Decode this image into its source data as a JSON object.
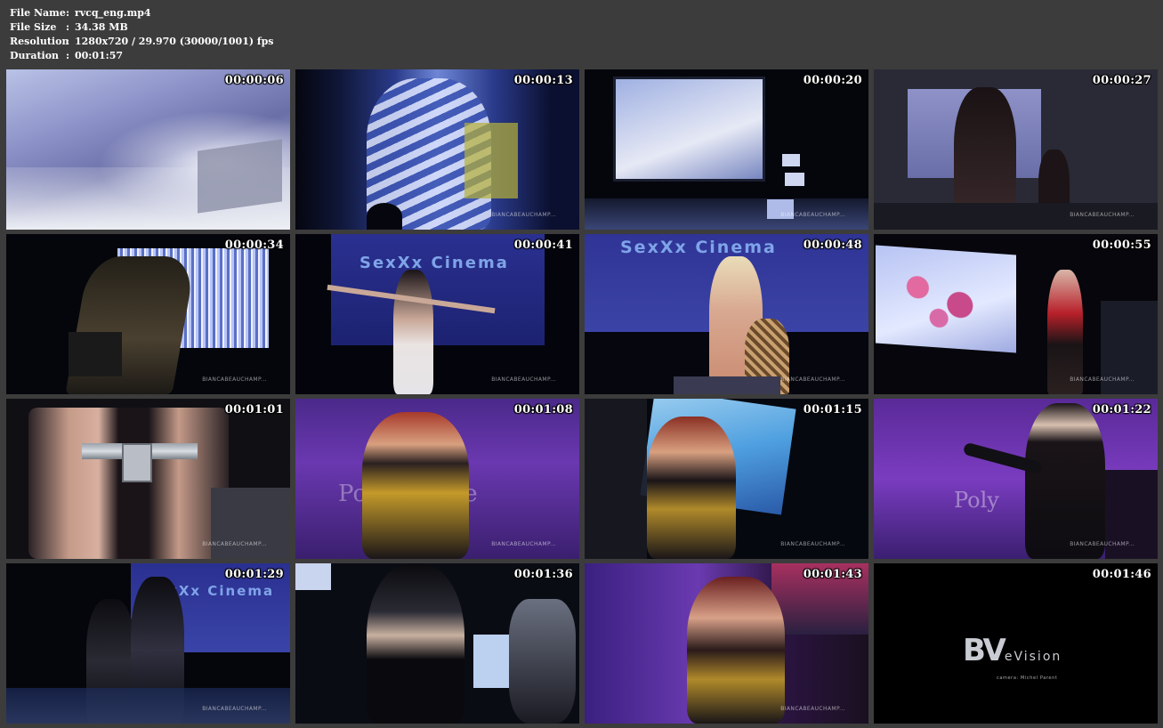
{
  "header": {
    "file_name_label": "File Name",
    "file_name": "rvcq_eng.mp4",
    "file_size_label": "File Size",
    "file_size": "34.38 MB",
    "resolution_label": "Resolution",
    "resolution": "1280x720 / 29.970 (30000/1001) fps",
    "duration_label": "Duration",
    "duration": "00:01:57",
    "separator": ":"
  },
  "thumbnails": [
    {
      "time": "00:00:06",
      "watermark": ""
    },
    {
      "time": "00:00:13",
      "watermark": "BIANCABEAUCHAMP..."
    },
    {
      "time": "00:00:20",
      "watermark": "BIANCABEAUCHAMP..."
    },
    {
      "time": "00:00:27",
      "watermark": "BIANCABEAUCHAMP..."
    },
    {
      "time": "00:00:34",
      "watermark": "BIANCABEAUCHAMP..."
    },
    {
      "time": "00:00:41",
      "watermark": "BIANCABEAUCHAMP...",
      "screen_text": "SexXx  Cinema"
    },
    {
      "time": "00:00:48",
      "watermark": "BIANCABEAUCHAMP...",
      "screen_text": "SexXx  Cinema"
    },
    {
      "time": "00:00:55",
      "watermark": "BIANCABEAUCHAMP..."
    },
    {
      "time": "00:01:01",
      "watermark": "BIANCABEAUCHAMP..."
    },
    {
      "time": "00:01:08",
      "watermark": "BIANCABEAUCHAMP...",
      "screen_text": "Polymorphe"
    },
    {
      "time": "00:01:15",
      "watermark": "BIANCABEAUCHAMP..."
    },
    {
      "time": "00:01:22",
      "watermark": "BIANCABEAUCHAMP...",
      "screen_text": "Poly"
    },
    {
      "time": "00:01:29",
      "watermark": "BIANCABEAUCHAMP...",
      "screen_text": "exXx  Cinema"
    },
    {
      "time": "00:01:36",
      "watermark": ""
    },
    {
      "time": "00:01:43",
      "watermark": "BIANCABEAUCHAMP..."
    },
    {
      "time": "00:01:46",
      "watermark": "",
      "logo_big": "BV",
      "logo_small": "eVision",
      "logo_credit": "camera: Michel Parent"
    }
  ],
  "colors": {
    "background": "#3c3c3c",
    "text": "#ffffff"
  }
}
